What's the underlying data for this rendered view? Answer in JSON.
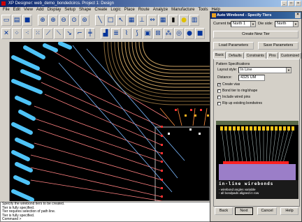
{
  "app": {
    "title": "XP Designer: web_demo_bondedcircs. Project 1: Design",
    "menu": [
      "File",
      "Edit",
      "View",
      "Add",
      "Display",
      "Setup",
      "Shape",
      "Create",
      "Logic",
      "Place",
      "Route",
      "Analyze",
      "Manufacture",
      "Tools",
      "Help"
    ]
  },
  "command_log": [
    "Specify the wirebond tiers to be created.",
    "Tier is fully specified.",
    "Tier requires selection of path line.",
    "Tier is fully specified.",
    "Command >"
  ],
  "dialog": {
    "title": "Auto Wirebond - Specify Tiers",
    "current_tier_label": "Current tier:",
    "current_tier_value": "North 1",
    "die_side_label": "Die side:",
    "die_side_value": "North",
    "create_new_tier": "Create New Tier",
    "load_parameters": "Load Parameters",
    "save_parameters": "Save Parameters",
    "tabs": [
      "Basic",
      "Defaults",
      "Constraints",
      "Pins",
      "Customized"
    ],
    "active_tab": "Basic",
    "pattern_heading": "Pattern Specifications",
    "layout_style_label": "Layout style:",
    "layout_style_value": "In Line",
    "distance_label": "Distance:",
    "distance_value": "4325 UM",
    "checkboxes": [
      {
        "label": "Create vias",
        "checked": true
      },
      {
        "label": "Bond tier to ring/shape",
        "checked": false
      },
      {
        "label": "Include wired pins",
        "checked": false
      },
      {
        "label": "Rip up existing bondwires",
        "checked": false
      }
    ],
    "preview_title": "in-line  wirebonds",
    "preview_notes": [
      "- wirebond angles variable",
      "- all bondpads aligned in row"
    ],
    "buttons": {
      "back": "Back",
      "next": "Next",
      "cancel": "Cancel",
      "help": "Help"
    }
  },
  "colors": {
    "titlebar": "#0a246a",
    "bond_pad": "#4fc3f7",
    "trace_ring": "#c8a060",
    "wire": "#ff6b6b"
  }
}
